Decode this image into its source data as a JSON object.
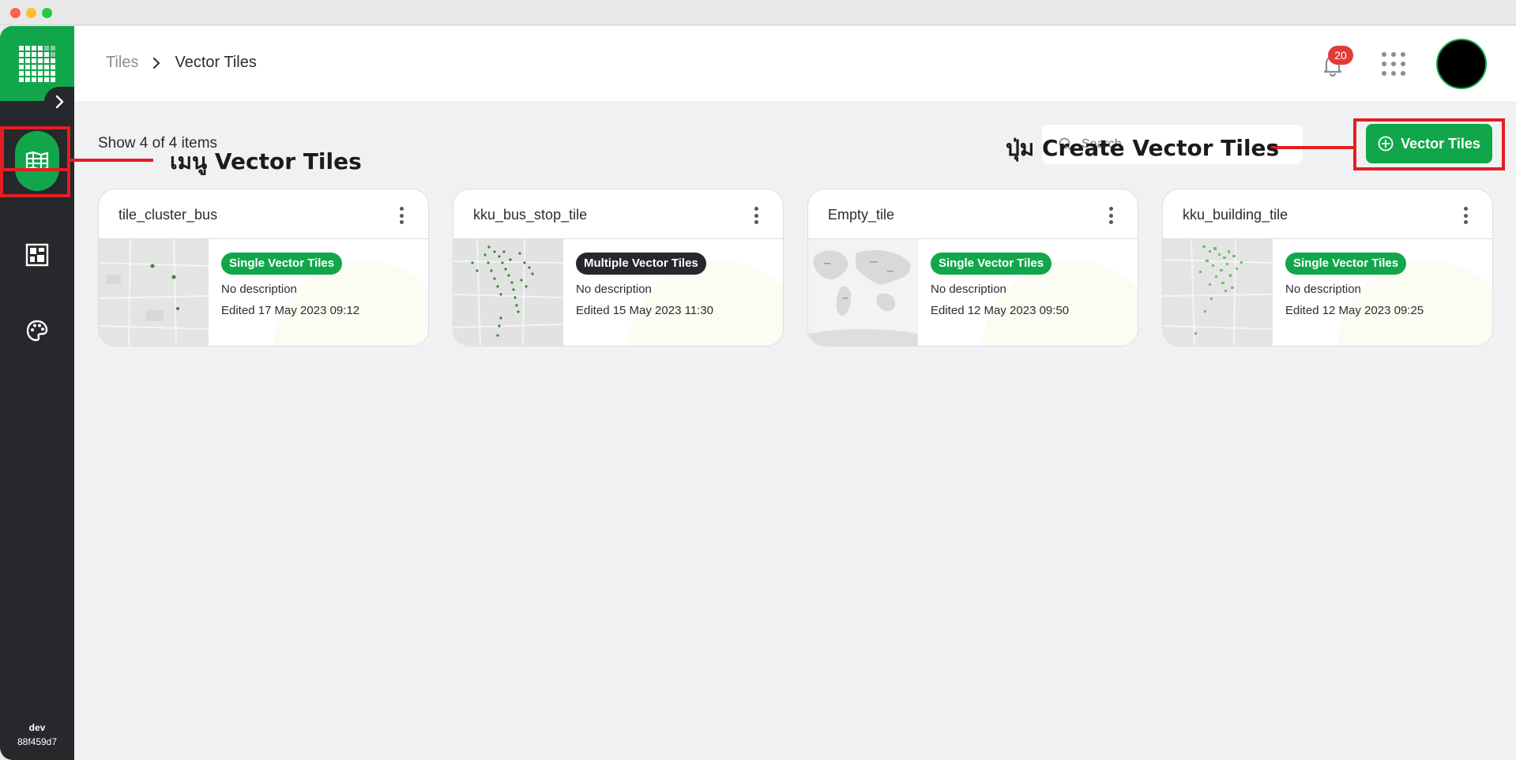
{
  "window": {
    "controls": [
      "close",
      "minimize",
      "zoom"
    ]
  },
  "sidebar": {
    "logo": "app-grid-logo",
    "items": [
      {
        "name": "vector-tiles",
        "icon": "map-icon",
        "active": true
      },
      {
        "name": "tiles",
        "icon": "grid-tiles-icon",
        "active": false
      },
      {
        "name": "styles",
        "icon": "palette-icon",
        "active": false
      }
    ],
    "footer": {
      "env": "dev",
      "build": "88f459d7"
    }
  },
  "header": {
    "breadcrumb": {
      "root": "Tiles",
      "current": "Vector Tiles"
    },
    "notifications": {
      "count": "20"
    }
  },
  "toolbar": {
    "count_text": "Show 4 of 4 items",
    "search_placeholder": "Search",
    "create_label": "Vector Tiles"
  },
  "cards": [
    {
      "title": "tile_cluster_bus",
      "tag": "Single Vector Tiles",
      "tag_type": "single",
      "description": "No description",
      "edited": "Edited 17 May 2023 09:12"
    },
    {
      "title": "kku_bus_stop_tile",
      "tag": "Multiple Vector Tiles",
      "tag_type": "multiple",
      "description": "No description",
      "edited": "Edited 15 May 2023 11:30"
    },
    {
      "title": "Empty_tile",
      "tag": "Single Vector Tiles",
      "tag_type": "single",
      "description": "No description",
      "edited": "Edited 12 May 2023 09:50"
    },
    {
      "title": "kku_building_tile",
      "tag": "Single Vector Tiles",
      "tag_type": "single",
      "description": "No description",
      "edited": "Edited 12 May 2023 09:25"
    }
  ],
  "annotations": {
    "menu_label": "เมนู Vector Tiles",
    "button_label": "ปุ่ม Create Vector Tiles"
  },
  "colors": {
    "brand": "#12a64b",
    "sidebar": "#26282b",
    "annotation": "#e31e24",
    "badge": "#e53935"
  }
}
